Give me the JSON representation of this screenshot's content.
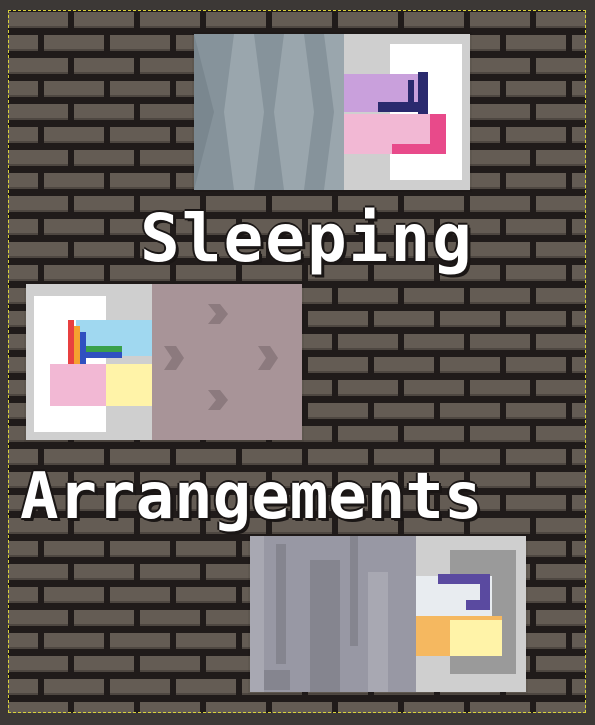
{
  "title": {
    "line1": "Sleeping",
    "line2": "Arrangements"
  },
  "colors": {
    "brick": "#645c54",
    "mortar": "#201b1a",
    "background_frame": "#3c3836",
    "selection_border": "#d8d23a",
    "title_text": "#ffffff",
    "title_outline": "#1a1615"
  },
  "cards": [
    {
      "name": "bed-card-grey-diamond",
      "pattern": "grey-diamond-carpet",
      "bed_colors": [
        "#c9a0dc",
        "#f2b8d4",
        "#e84a8a",
        "#2a2a6e"
      ]
    },
    {
      "name": "bed-card-rainbow-hearts",
      "pattern": "mauve-hearts-carpet",
      "bed_colors": [
        "#e84040",
        "#f5a030",
        "#3aa04a",
        "#3050c0",
        "#a0d8f0",
        "#fff3a8",
        "#f2b8d4"
      ]
    },
    {
      "name": "bed-card-stone-orange",
      "pattern": "grey-stone-carpet",
      "bed_colors": [
        "#5a4aa0",
        "#f5b860",
        "#fff3a8",
        "#e8ecf0"
      ]
    }
  ]
}
